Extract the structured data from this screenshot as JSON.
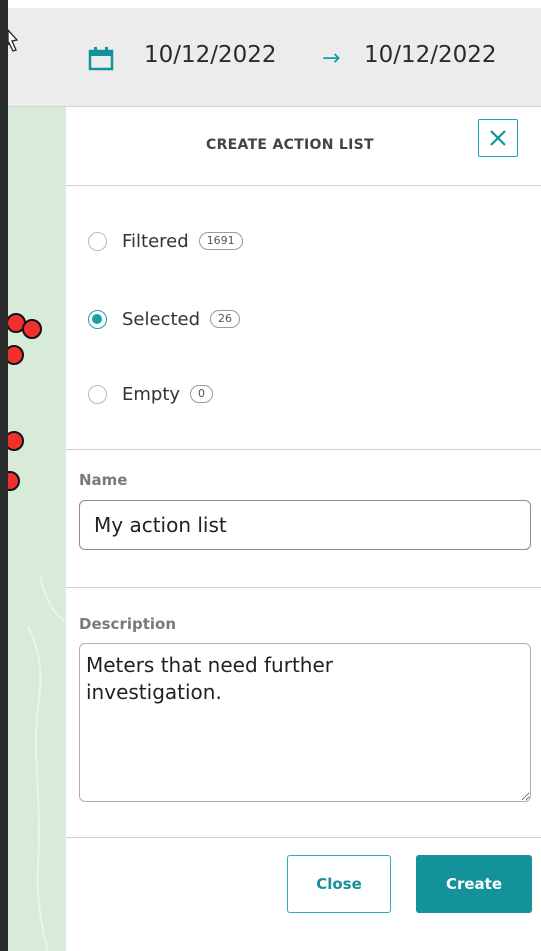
{
  "header": {
    "date_start": "10/12/2022",
    "date_end": "10/12/2022",
    "icons": {
      "calendar": "calendar-icon",
      "arrow": "arrow-right-icon"
    }
  },
  "panel": {
    "title": "CREATE ACTION LIST",
    "close_icon": "close-icon",
    "options": [
      {
        "label": "Filtered",
        "count": "1691",
        "checked": false
      },
      {
        "label": "Selected",
        "count": "26",
        "checked": true
      },
      {
        "label": "Empty",
        "count": "0",
        "checked": false
      }
    ],
    "name_label": "Name",
    "name_value": "My action list",
    "description_label": "Description",
    "description_value": "Meters that need further\ninvestigation.",
    "close_label": "Close",
    "create_label": "Create"
  },
  "colors": {
    "accent": "#13929a",
    "map_bg": "#d8ebd9",
    "marker": "#f0302a"
  }
}
